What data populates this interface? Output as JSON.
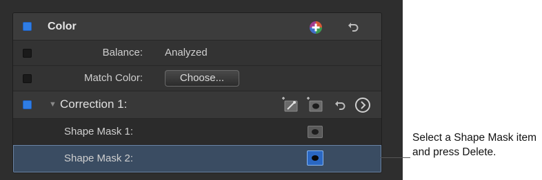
{
  "color_section": {
    "title": "Color",
    "enabled": true,
    "add_icon": "color-board-add-icon",
    "reset_icon": "reset-arrow-icon"
  },
  "balance": {
    "label": "Balance:",
    "value": "Analyzed",
    "enabled": false
  },
  "match_color": {
    "label": "Match Color:",
    "button_label": "Choose...",
    "enabled": false
  },
  "correction": {
    "title": "Correction 1:",
    "enabled": true,
    "icons": [
      "color-mask-icon",
      "add-shape-mask-icon",
      "reset-arrow-icon",
      "go-forward-icon"
    ]
  },
  "masks": [
    {
      "label": "Shape Mask 1:",
      "selected": false
    },
    {
      "label": "Shape Mask 2:",
      "selected": true
    }
  ],
  "callout": {
    "text": "Select a Shape Mask item and press Delete."
  },
  "colors": {
    "accent": "#2f7de4",
    "panel": "#333333",
    "selected_row": "#3a4c62"
  }
}
